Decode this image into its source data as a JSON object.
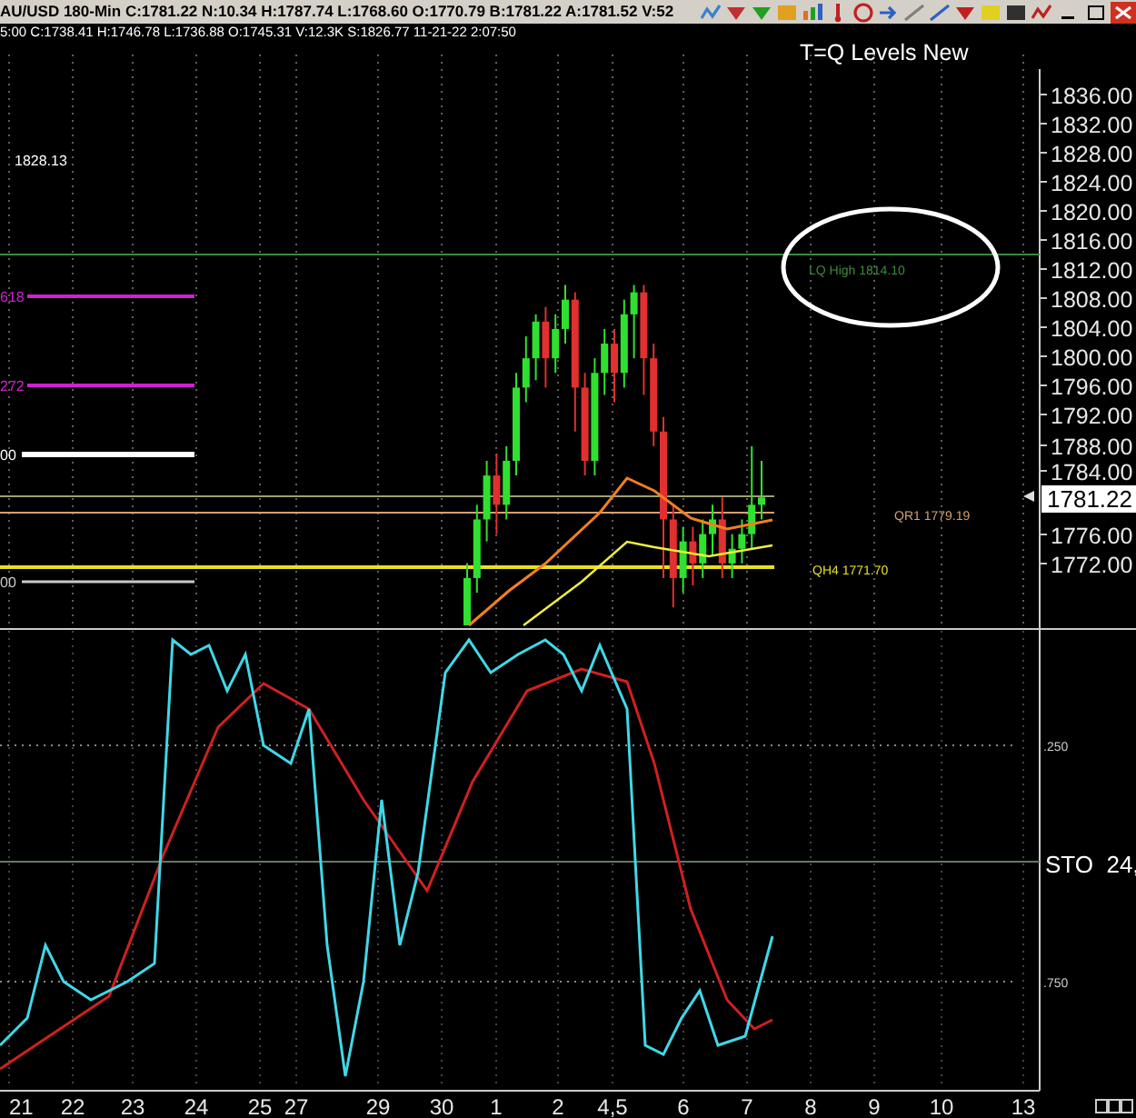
{
  "header": {
    "quote_line": "AU/USD 180-Min C:1781.22 N:10.34 H:1787.74 L:1768.60 O:1770.79 B:1781.22 A:1781.52 V:52",
    "bar_info": "5:00 C:1738.41 H:1746.78 L:1736.88 O:1745.31 V:12.3K S:1826.77 11-21-22 2:07:50"
  },
  "chart": {
    "title": "T=Q Levels New",
    "price_note": "1828.13",
    "fib_labels": [
      {
        "text": "618",
        "color": "#d020d0"
      },
      {
        "text": "272",
        "color": "#d020d0"
      },
      {
        "text": "00",
        "color": "#ffffff"
      },
      {
        "text": "00",
        "color": "#c8c8c8"
      }
    ],
    "levels": [
      {
        "label": "LQ High 1814.10",
        "color": "#3c8c3c"
      },
      {
        "label": "QR1 1779.19",
        "color": "#d8a070"
      },
      {
        "label": "QH4 1771.70",
        "color": "#e8e020"
      }
    ],
    "price_axis": [
      "1836.00",
      "1832.00",
      "1828.00",
      "1824.00",
      "1820.00",
      "1816.00",
      "1812.00",
      "1808.00",
      "1804.00",
      "1800.00",
      "1796.00",
      "1792.00",
      "1788.00",
      "1784.00",
      "1776.00",
      "1772.00"
    ],
    "current_price": "1781.22",
    "oscillator": {
      "upper_label": ".250",
      "name": "STO  24,",
      "lower_label": ".750"
    },
    "date_axis": [
      "21",
      "22",
      "23",
      "24",
      "25",
      "27",
      "29",
      "30",
      "1",
      "2",
      "4,5",
      "6",
      "7",
      "8",
      "9",
      "10",
      "13"
    ]
  }
}
